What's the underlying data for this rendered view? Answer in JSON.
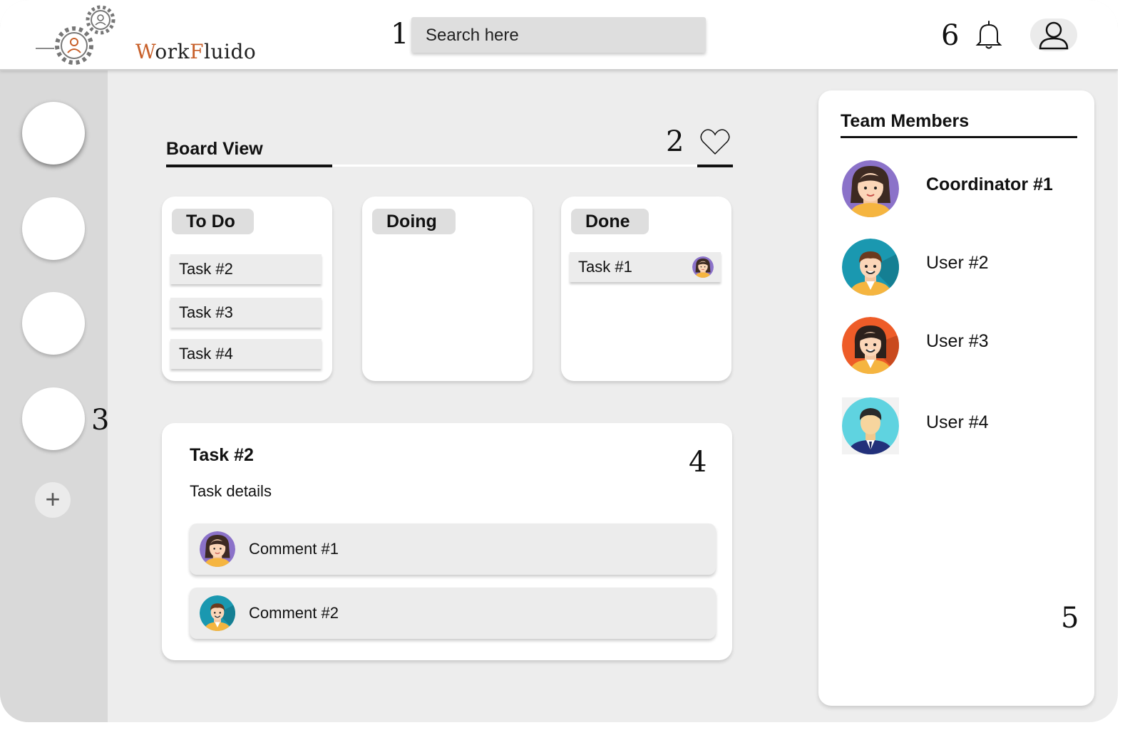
{
  "header": {
    "logo_text_a": "W",
    "logo_text_b": "ork",
    "logo_text_c": "F",
    "logo_text_d": "luido",
    "marker_1": "1",
    "search_placeholder": "Search here",
    "marker_6": "6"
  },
  "sidebar": {
    "marker_3": "3",
    "add_label": "+"
  },
  "board": {
    "title": "Board View",
    "marker_2": "2",
    "columns": [
      {
        "label": "To Do",
        "tasks": [
          "Task #2",
          "Task #3",
          "Task #4"
        ]
      },
      {
        "label": "Doing",
        "tasks": []
      },
      {
        "label": "Done",
        "tasks": [
          "Task #1"
        ]
      }
    ]
  },
  "detail": {
    "title": "Task #2",
    "marker_4": "4",
    "subtitle": "Task details",
    "comments": [
      "Comment #1",
      "Comment #2"
    ]
  },
  "team": {
    "title": "Team Members",
    "marker_5": "5",
    "members": [
      {
        "name": "Coordinator #1",
        "avatar": "woman-purple"
      },
      {
        "name": "User #2",
        "avatar": "man-teal"
      },
      {
        "name": "User #3",
        "avatar": "woman-orange"
      },
      {
        "name": "User #4",
        "avatar": "man-cyan"
      }
    ]
  },
  "colors": {
    "logo_accent": "#c8602a",
    "sidebar_bg": "#d9d9d9",
    "canvas_bg": "#ededed"
  }
}
